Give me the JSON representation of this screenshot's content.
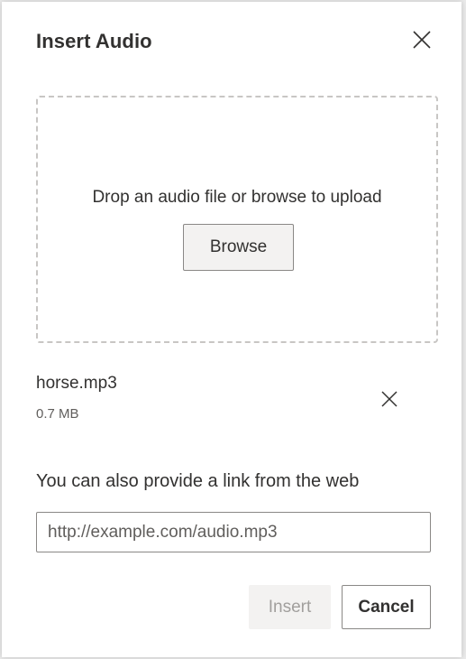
{
  "dialog": {
    "title": "Insert Audio",
    "close_icon": "close-icon"
  },
  "dropzone": {
    "text": "Drop an audio file or browse to upload",
    "browse_label": "Browse"
  },
  "file": {
    "name": "horse.mp3",
    "size": "0.7 MB",
    "remove_icon": "close-icon"
  },
  "link": {
    "label": "You can also provide a link from the web",
    "placeholder": "http://example.com/audio.mp3",
    "value": ""
  },
  "actions": {
    "insert_label": "Insert",
    "insert_disabled": true,
    "cancel_label": "Cancel"
  },
  "colors": {
    "text": "#323130",
    "muted": "#605e5c",
    "disabled_text": "#a19f9d",
    "border": "#8a8886",
    "dashed_border": "#c8c6c4",
    "neutral_fill": "#f3f2f1"
  }
}
